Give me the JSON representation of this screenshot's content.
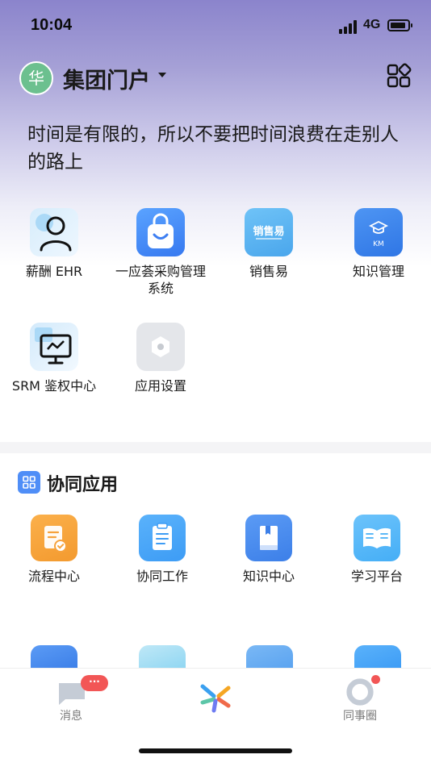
{
  "status_bar": {
    "time": "10:04",
    "network": "4G"
  },
  "header": {
    "avatar_text": "华",
    "title": "集团门户"
  },
  "motto": "时间是有限的，所以不要把时间浪费在走别人的路上",
  "apps": [
    {
      "label": "薪酬 EHR",
      "icon": "person-icon"
    },
    {
      "label": "一应荟采购管理系统",
      "icon": "shopping-bag-icon"
    },
    {
      "label": "销售易",
      "icon": "sales-logo-icon",
      "tile_text": "销售易"
    },
    {
      "label": "知识管理",
      "icon": "graduation-cap-icon",
      "tile_text": "KM"
    },
    {
      "label": "SRM 鉴权中心",
      "icon": "monitor-icon"
    },
    {
      "label": "应用设置",
      "icon": "hexagon-settings-icon"
    }
  ],
  "collab_section": {
    "title": "协同应用",
    "apps": [
      {
        "label": "流程中心",
        "icon": "process-doc-icon"
      },
      {
        "label": "协同工作",
        "icon": "clipboard-icon"
      },
      {
        "label": "知识中心",
        "icon": "book-icon"
      },
      {
        "label": "学习平台",
        "icon": "open-book-icon"
      }
    ]
  },
  "tabbar": {
    "tabs": [
      {
        "label": "消息",
        "icon": "message-icon",
        "badge": "···"
      },
      {
        "label": "",
        "icon": "app-logo-icon"
      },
      {
        "label": "同事圈",
        "icon": "colleague-circle-icon"
      }
    ]
  },
  "colors": {
    "accent_blue": "#4f8ef7",
    "badge_red": "#f25656",
    "orange": "#f6a23c",
    "avatar_green": "#6cc08f"
  }
}
